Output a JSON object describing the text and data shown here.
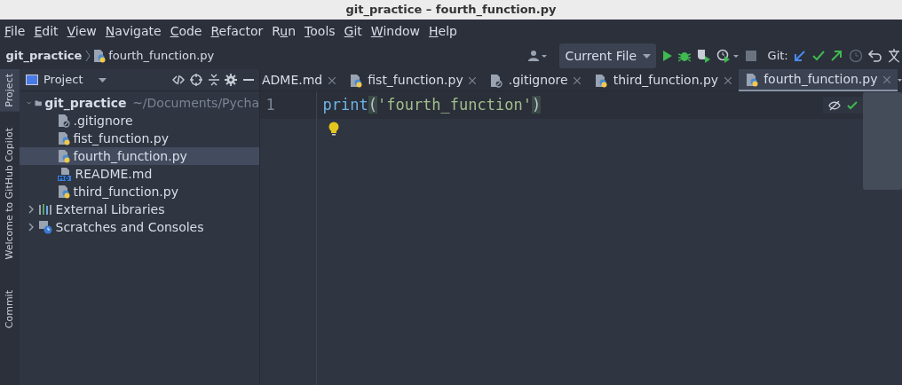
{
  "window": {
    "title": "git_practice – fourth_function.py"
  },
  "menu": [
    {
      "mnemonic": "F",
      "rest": "ile"
    },
    {
      "mnemonic": "E",
      "rest": "dit"
    },
    {
      "mnemonic": "V",
      "rest": "iew"
    },
    {
      "mnemonic": "N",
      "rest": "avigate"
    },
    {
      "mnemonic": "C",
      "rest": "ode"
    },
    {
      "mnemonic": "R",
      "rest": "efactor"
    },
    {
      "before": "R",
      "mnemonic": "u",
      "rest": "n"
    },
    {
      "mnemonic": "T",
      "rest": "ools"
    },
    {
      "mnemonic": "G",
      "rest": "it"
    },
    {
      "mnemonic": "W",
      "rest": "indow"
    },
    {
      "mnemonic": "H",
      "rest": "elp"
    }
  ],
  "breadcrumb": {
    "project": "git_practice",
    "file": "fourth_function.py"
  },
  "toolbar": {
    "run_config": "Current File",
    "git_label": "Git:"
  },
  "side_tabs": [
    {
      "label": "Project",
      "selected": true
    },
    {
      "label": "Welcome to GitHub Copilot",
      "selected": false
    },
    {
      "label": "Commit",
      "selected": false
    }
  ],
  "project_panel": {
    "title": "Project",
    "tree": [
      {
        "label": "git_practice",
        "path": "~/Documents/Pycha",
        "kind": "folder",
        "expanded": true,
        "selected": false,
        "children": [
          {
            "label": ".gitignore",
            "kind": "ignore",
            "selected": false
          },
          {
            "label": "fist_function.py",
            "kind": "python",
            "selected": false
          },
          {
            "label": "fourth_function.py",
            "kind": "python",
            "selected": true
          },
          {
            "label": "README.md",
            "kind": "markdown",
            "selected": false
          },
          {
            "label": "third_function.py",
            "kind": "python",
            "selected": false
          }
        ]
      },
      {
        "label": "External Libraries",
        "kind": "libraries",
        "expanded": false,
        "selected": false
      },
      {
        "label": "Scratches and Consoles",
        "kind": "scratches",
        "expanded": false,
        "selected": false
      }
    ]
  },
  "editor_tabs": [
    {
      "label": "ADME.md",
      "selected": false
    },
    {
      "label": "fist_function.py",
      "kind": "python",
      "selected": false
    },
    {
      "label": ".gitignore",
      "kind": "ignore",
      "selected": false
    },
    {
      "label": "third_function.py",
      "kind": "python",
      "selected": false
    },
    {
      "label": "fourth_function.py",
      "kind": "python",
      "selected": true
    }
  ],
  "editor": {
    "lines": [
      {
        "number": "1",
        "current": true,
        "tokens": [
          {
            "text": "print",
            "kind": "builtin"
          },
          {
            "text": "(",
            "kind": "paren"
          },
          {
            "text": "'fourth_function'",
            "kind": "string"
          },
          {
            "text": ")",
            "kind": "paren"
          }
        ]
      }
    ]
  }
}
